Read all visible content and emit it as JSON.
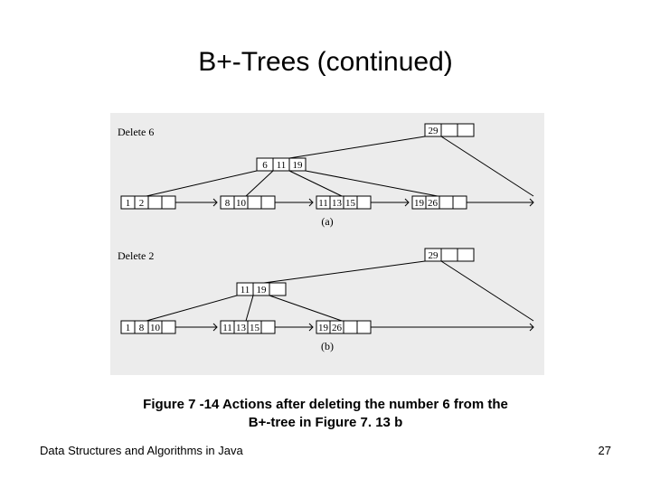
{
  "title": "B+-Trees (continued)",
  "caption_line1": "Figure 7 -14 Actions after deleting the number 6 from the",
  "caption_line2": "B+-tree in Figure 7. 13 b",
  "footer_left": "Data Structures and Algorithms in Java",
  "footer_right": "27",
  "diagram_a": {
    "label_op": "Delete 6",
    "sub_label": "(a)",
    "root_keys": [
      "29"
    ],
    "internal_keys": [
      "6",
      "11",
      "19"
    ],
    "leaves": [
      [
        "1",
        "2"
      ],
      [
        "8",
        "10"
      ],
      [
        "11",
        "13",
        "15"
      ],
      [
        "19",
        "26"
      ]
    ]
  },
  "diagram_b": {
    "label_op": "Delete 2",
    "sub_label": "(b)",
    "root_keys": [
      "29"
    ],
    "internal_keys": [
      "11",
      "19"
    ],
    "leaves": [
      [
        "1",
        "8",
        "10"
      ],
      [
        "11",
        "13",
        "15"
      ],
      [
        "19",
        "26"
      ]
    ]
  }
}
